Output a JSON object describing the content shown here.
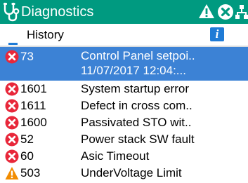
{
  "header": {
    "title": "Diagnostics",
    "icons": [
      "stethoscope-icon",
      "warning-icon",
      "error-icon",
      "network-icon"
    ]
  },
  "subheader": {
    "title": "History",
    "info_icon": "i"
  },
  "colors": {
    "header_bg": "#009a80",
    "selected_row_bg": "#3c82d5",
    "error_red": "#e8273a",
    "warning_orange": "#f28c00",
    "info_blue": "#1f7bd6"
  },
  "events": [
    {
      "type": "error",
      "code": "73",
      "description": "Control Panel setpoi..",
      "timestamp": "11/07/2017 12:04:...",
      "selected": true
    },
    {
      "type": "error",
      "code": "1601",
      "description": "System startup error"
    },
    {
      "type": "error",
      "code": "1611",
      "description": "Defect in cross com.."
    },
    {
      "type": "error",
      "code": "1600",
      "description": "Passivated STO wit.."
    },
    {
      "type": "error",
      "code": "52",
      "description": "Power stack SW fault"
    },
    {
      "type": "error",
      "code": "60",
      "description": "Asic Timeout"
    },
    {
      "type": "warning",
      "code": "503",
      "description": "UnderVoltage Limit"
    }
  ]
}
